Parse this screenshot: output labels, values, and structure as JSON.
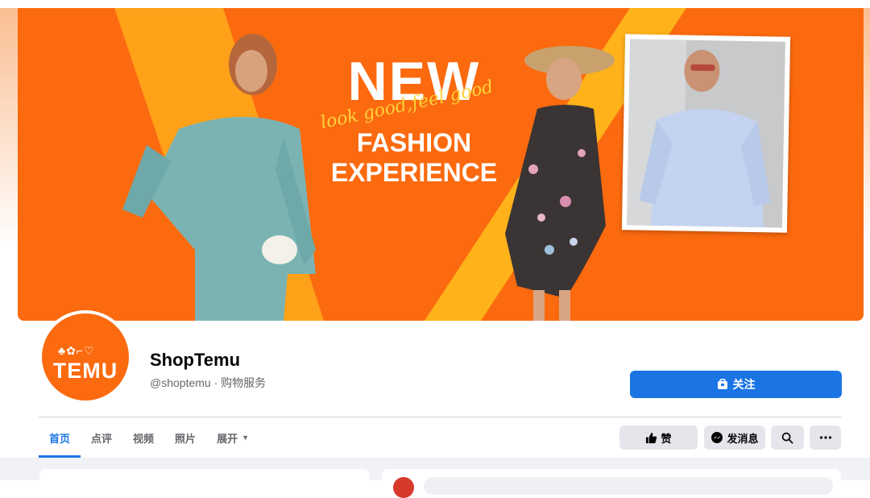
{
  "cover": {
    "headline_new": "NEW",
    "headline_script": "look good,feel good",
    "headline_line1": "FASHION",
    "headline_line2": "EXPERIENCE",
    "colors": {
      "orange": "#fb6a0f",
      "accent_yellow": "#ffb21a",
      "script": "#ffd23a"
    }
  },
  "avatar": {
    "brand_text": "TEMU",
    "icons_text": "♣✿⌐♡"
  },
  "profile": {
    "name": "ShopTemu",
    "subtitle": "@shoptemu · 购物服务"
  },
  "follow_button": {
    "label": "关注",
    "icon": "follow-icon",
    "color": "#1b74e4"
  },
  "tabs": [
    {
      "label": "首页",
      "active": true
    },
    {
      "label": "点评",
      "active": false
    },
    {
      "label": "视频",
      "active": false
    },
    {
      "label": "照片",
      "active": false
    },
    {
      "label": "展开",
      "active": false
    }
  ],
  "actions": {
    "like_label": "赞",
    "message_label": "发消息",
    "icons": [
      "thumbs-up-icon",
      "messenger-icon",
      "search-icon",
      "more-icon"
    ]
  }
}
